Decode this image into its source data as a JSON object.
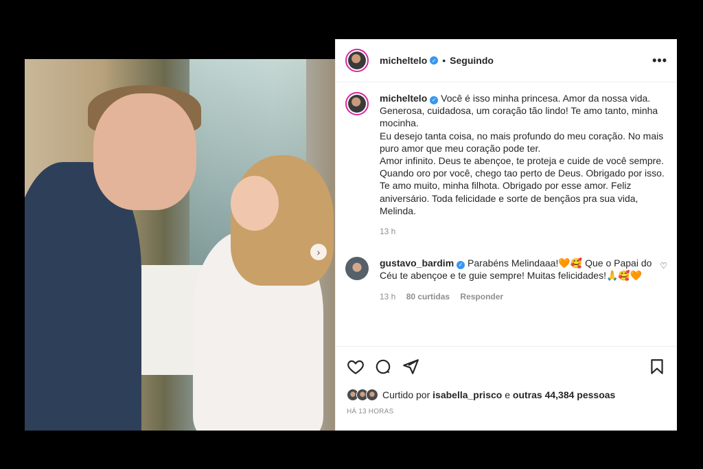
{
  "post": {
    "author": "micheltelo",
    "separator": "•",
    "follow_status": "Seguindo",
    "more_label": "•••"
  },
  "caption": {
    "author": "micheltelo",
    "lines": [
      "Você é isso minha princesa. Amor da nossa vida. Generosa, cuidadosa, um coração tão lindo! Te amo tanto, minha mocinha.",
      "Eu desejo tanta coisa, no mais profundo do meu coração. No mais puro amor que meu coração pode ter.",
      "Amor infinito. Deus te abençoe, te proteja e cuide de você sempre.",
      "Quando oro por você, chego tao perto de Deus. Obrigado por isso. Te amo muito, minha filhota. Obrigado por esse amor. Feliz aniversário. Toda felicidade e sorte de bençãos pra sua vida, Melinda."
    ],
    "time": "13 h"
  },
  "comment": {
    "author": "gustavo_bardim",
    "text": "Parabéns Melindaaa!🧡🥰 Que o Papai do Céu te abençoe e te guie sempre! Muitas felicidades!🙏🥰🧡",
    "time": "13 h",
    "likes": "80 curtidas",
    "reply": "Responder"
  },
  "likes": {
    "prefix": "Curtido por",
    "user": "isabella_prisco",
    "middle": "e",
    "others": "outras 44,384 pessoas"
  },
  "timestamp": "HÁ 13 HORAS",
  "icons": {
    "like": "heart-icon",
    "comment": "comment-icon",
    "share": "share-icon",
    "save": "bookmark-icon",
    "verified": "verified-icon"
  },
  "colors": {
    "verified": "#3897f0",
    "story_ring": "#d6249f",
    "muted": "#8e8e8e"
  }
}
